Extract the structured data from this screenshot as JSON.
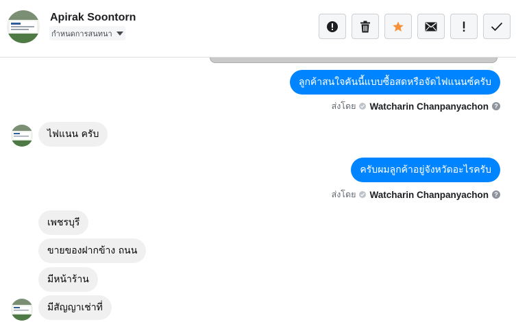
{
  "header": {
    "contact_name": "Apirak Soontorn",
    "assign_label": "กำหนดการสนทนา"
  },
  "toolbar": {
    "buttons": [
      {
        "name": "mark-spam-button",
        "icon": "alert-circle-icon"
      },
      {
        "name": "delete-button",
        "icon": "trash-icon"
      },
      {
        "name": "star-button",
        "icon": "star-icon",
        "color": "#f7923b"
      },
      {
        "name": "mark-unread-button",
        "icon": "envelope-icon"
      },
      {
        "name": "follow-up-button",
        "icon": "exclamation-icon"
      },
      {
        "name": "mark-done-button",
        "icon": "check-icon"
      }
    ]
  },
  "messages": {
    "m1": "ลูกค้าสนใจคันนี้แบบซื้อสดหรือจัดไฟแนนซ์ครับ",
    "m2": "ไฟแนน ครับ",
    "m3": "ครับผมลูกค้าอยู่จังหวัดอะไรครับ",
    "m4": "เพชรบุรี",
    "m5": "ขายของฝากข้าง ถนน",
    "m6": "มีหน้าร้าน",
    "m7": "มีสัญญาเช่าที่"
  },
  "sent_by": {
    "label": "ส่งโดย",
    "name": "Watcharin Chanpanyachon"
  },
  "colors": {
    "outgoing_bubble": "#0084ff",
    "incoming_bubble": "#f0f0f0",
    "accent_star": "#f7923b"
  }
}
